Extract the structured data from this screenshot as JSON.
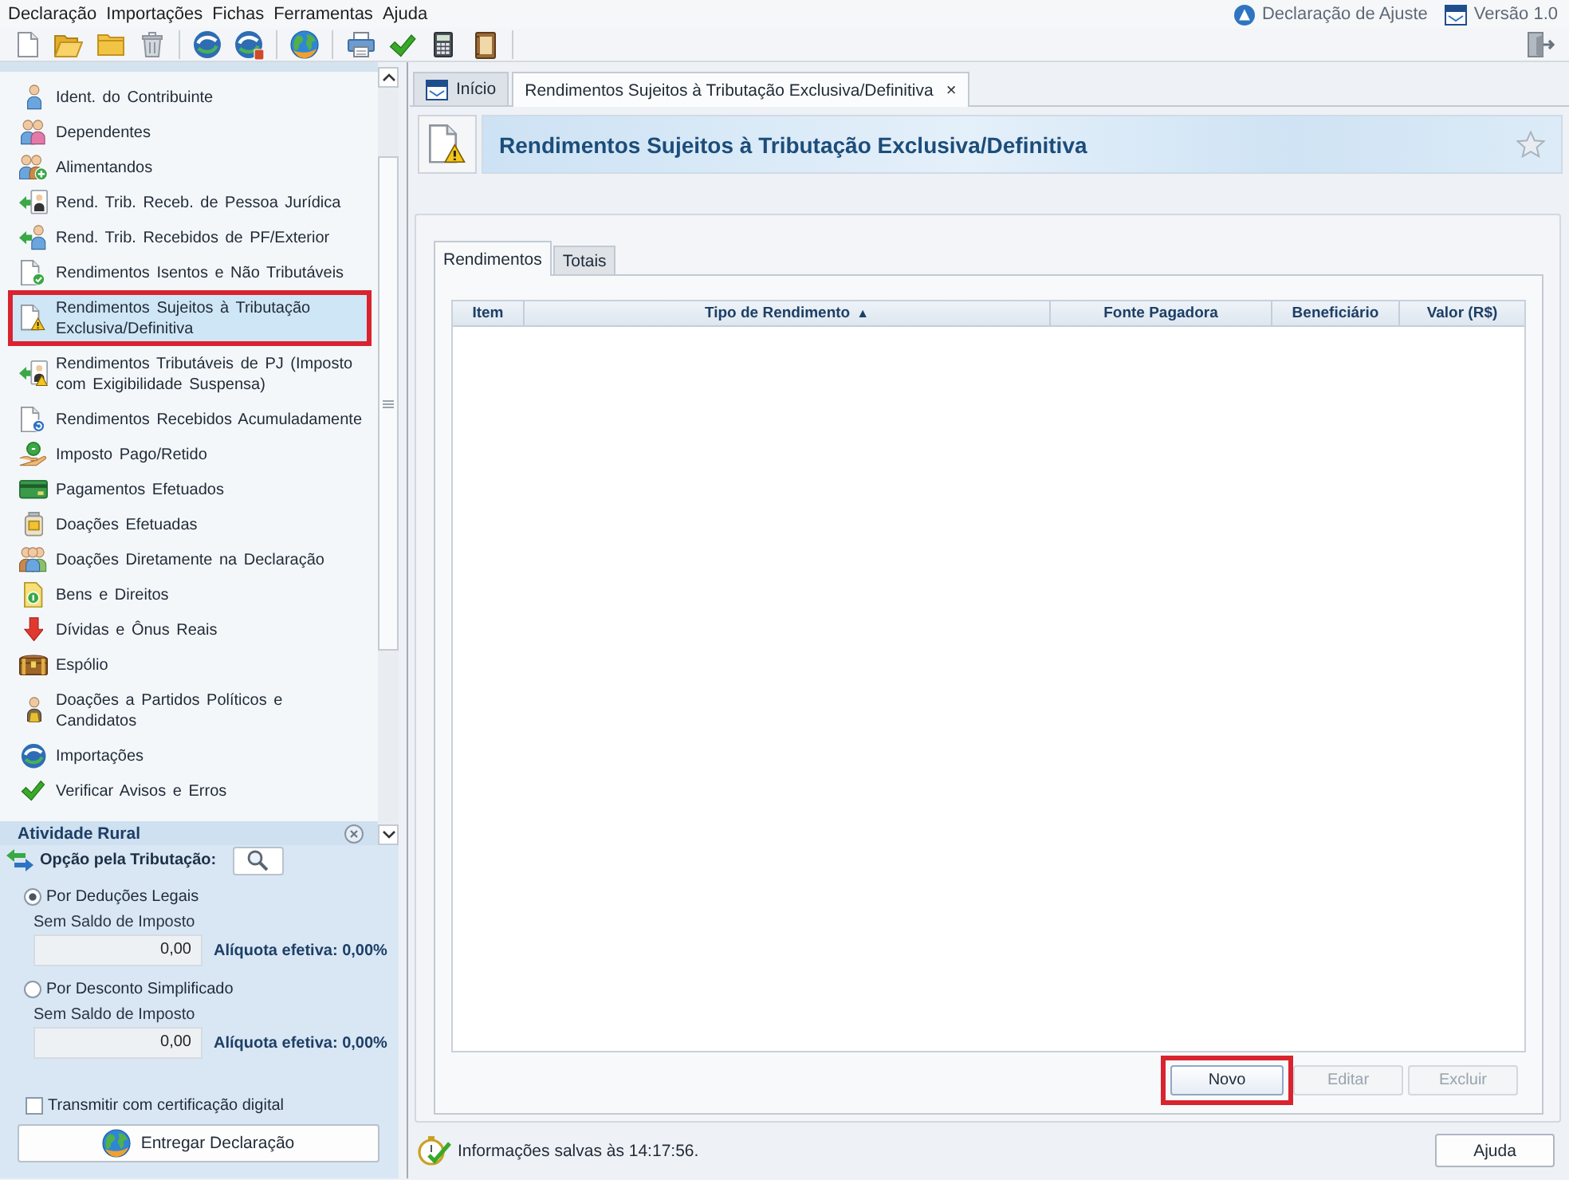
{
  "menu": {
    "items": [
      "Declaração",
      "Importações",
      "Fichas",
      "Ferramentas",
      "Ajuda"
    ],
    "indicators": [
      "Declaração de Ajuste",
      "Versão 1.0"
    ]
  },
  "sidebar": {
    "items": [
      {
        "label": "Ident. do Contribuinte",
        "selected": false,
        "highlighted": false
      },
      {
        "label": "Dependentes",
        "selected": false,
        "highlighted": false
      },
      {
        "label": "Alimentandos",
        "selected": false,
        "highlighted": false
      },
      {
        "label": "Rend. Trib. Receb. de Pessoa Jurídica",
        "selected": false,
        "highlighted": false
      },
      {
        "label": "Rend. Trib. Recebidos de PF/Exterior",
        "selected": false,
        "highlighted": false
      },
      {
        "label": "Rendimentos Isentos e Não Tributáveis",
        "selected": false,
        "highlighted": false
      },
      {
        "label": "Rendimentos Sujeitos à Tributação Exclusiva/Definitiva",
        "selected": true,
        "highlighted": true
      },
      {
        "label": "Rendimentos Tributáveis de PJ (Imposto com Exigibilidade Suspensa)",
        "selected": false,
        "highlighted": false
      },
      {
        "label": "Rendimentos Recebidos Acumuladamente",
        "selected": false,
        "highlighted": false
      },
      {
        "label": "Imposto Pago/Retido",
        "selected": false,
        "highlighted": false
      },
      {
        "label": "Pagamentos Efetuados",
        "selected": false,
        "highlighted": false
      },
      {
        "label": "Doações Efetuadas",
        "selected": false,
        "highlighted": false
      },
      {
        "label": "Doações Diretamente na Declaração",
        "selected": false,
        "highlighted": false
      },
      {
        "label": "Bens e Direitos",
        "selected": false,
        "highlighted": false
      },
      {
        "label": "Dívidas e Ônus Reais",
        "selected": false,
        "highlighted": false
      },
      {
        "label": "Espólio",
        "selected": false,
        "highlighted": false
      },
      {
        "label": "Doações a Partidos Políticos e Candidatos",
        "selected": false,
        "highlighted": false
      },
      {
        "label": "Importações",
        "selected": false,
        "highlighted": false
      },
      {
        "label": "Verificar Avisos e Erros",
        "selected": false,
        "highlighted": false
      }
    ],
    "section": {
      "title": "Atividade Rural"
    }
  },
  "tax_option": {
    "title": "Opção pela Tributação:",
    "options": [
      {
        "label": "Por Deduções Legais",
        "selected": true,
        "caption": "Sem Saldo de Imposto",
        "value": "0,00",
        "rate": "Alíquota efetiva: 0,00%"
      },
      {
        "label": "Por Desconto Simplificado",
        "selected": false,
        "caption": "Sem Saldo de Imposto",
        "value": "0,00",
        "rate": "Alíquota efetiva: 0,00%"
      }
    ],
    "certificate": {
      "label": "Transmitir com certificação digital",
      "checked": false
    },
    "submit": "Entregar Declaração"
  },
  "tabs": [
    {
      "label": "Início",
      "kind": "home",
      "selected": false
    },
    {
      "label": "Rendimentos Sujeitos à Tributação Exclusiva/Definitiva",
      "kind": "document",
      "selected": true,
      "close": "×"
    }
  ],
  "page_header": {
    "title": "Rendimentos Sujeitos à Tributação Exclusiva/Definitiva"
  },
  "inner_tabs": [
    {
      "label": "Rendimentos",
      "selected": true
    },
    {
      "label": "Totais",
      "selected": false
    }
  ],
  "table": {
    "columns": [
      {
        "label": "Item"
      },
      {
        "label": "Tipo de Rendimento",
        "sort_mark": "▲"
      },
      {
        "label": "Fonte Pagadora"
      },
      {
        "label": "Beneficiário"
      },
      {
        "label": "Valor (R$)"
      }
    ]
  },
  "actions": [
    {
      "label": "Novo",
      "disabled": false,
      "highlighted": true
    },
    {
      "label": "Editar",
      "disabled": true,
      "highlighted": false
    },
    {
      "label": "Excluir",
      "disabled": true,
      "highlighted": false
    }
  ],
  "status_bar": {
    "message": "Informações salvas às 14:17:56.",
    "help_button": "Ajuda"
  }
}
